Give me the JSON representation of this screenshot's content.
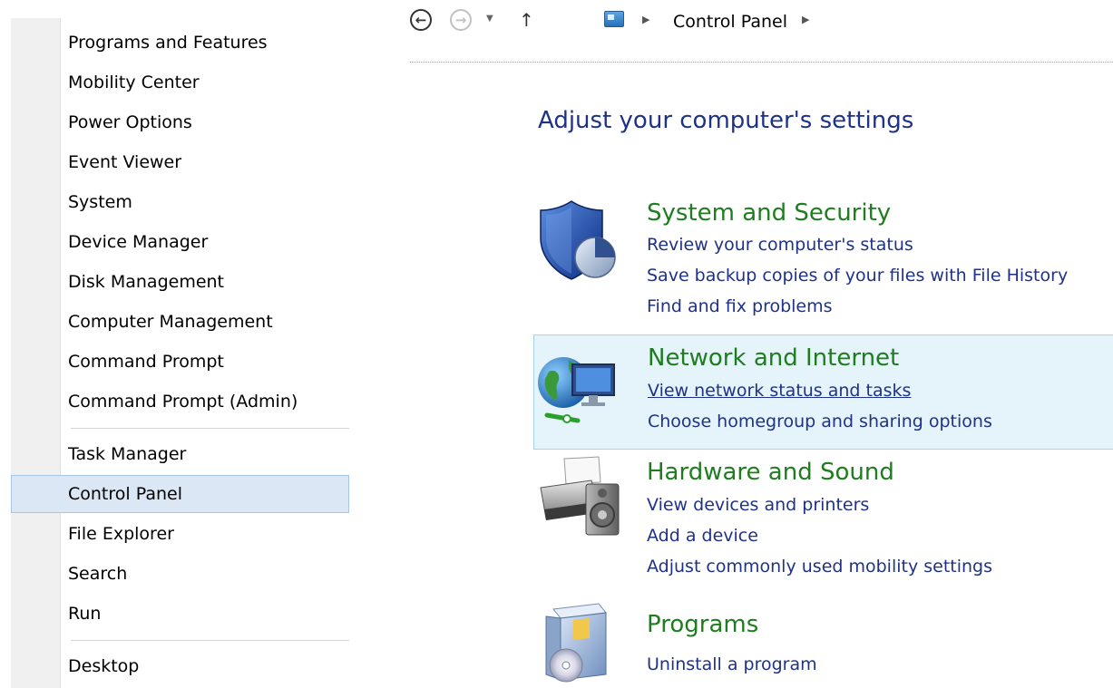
{
  "winx_menu": {
    "items": [
      {
        "label": "Programs and Features"
      },
      {
        "label": "Mobility Center"
      },
      {
        "label": "Power Options"
      },
      {
        "label": "Event Viewer"
      },
      {
        "label": "System"
      },
      {
        "label": "Device Manager"
      },
      {
        "label": "Disk Management"
      },
      {
        "label": "Computer Management"
      },
      {
        "label": "Command Prompt"
      },
      {
        "label": "Command Prompt (Admin)"
      },
      {
        "label": "Task Manager"
      },
      {
        "label": "Control Panel",
        "selected": true
      },
      {
        "label": "File Explorer"
      },
      {
        "label": "Search"
      },
      {
        "label": "Run"
      },
      {
        "label": "Desktop"
      }
    ]
  },
  "nav": {
    "back_icon": "arrow-left-circle-icon",
    "forward_icon": "arrow-right-circle-icon",
    "recent_icon": "chevron-down-icon",
    "up_icon": "arrow-up-icon",
    "location_icon": "control-panel-icon",
    "breadcrumb": [
      "Control Panel"
    ]
  },
  "content": {
    "title": "Adjust your computer's settings",
    "categories": [
      {
        "icon": "shield-icon",
        "title": "System and Security",
        "links": [
          "Review your computer's status",
          "Save backup copies of your files with File History",
          "Find and fix problems"
        ]
      },
      {
        "icon": "network-globe-icon",
        "title": "Network and Internet",
        "links": [
          "View network status and tasks",
          "Choose homegroup and sharing options"
        ],
        "hovered": true
      },
      {
        "icon": "printer-speaker-icon",
        "title": "Hardware and Sound",
        "links": [
          "View devices and printers",
          "Add a device",
          "Adjust commonly used mobility settings"
        ]
      },
      {
        "icon": "programs-box-icon",
        "title": "Programs",
        "links": [
          "Uninstall a program"
        ]
      }
    ]
  },
  "colors": {
    "title_blue": "#1e3287",
    "category_green": "#1e7d1e",
    "link_blue": "#1e3287",
    "menu_selected_bg": "#dbe7f4",
    "hover_bg": "#e5f3fb"
  }
}
